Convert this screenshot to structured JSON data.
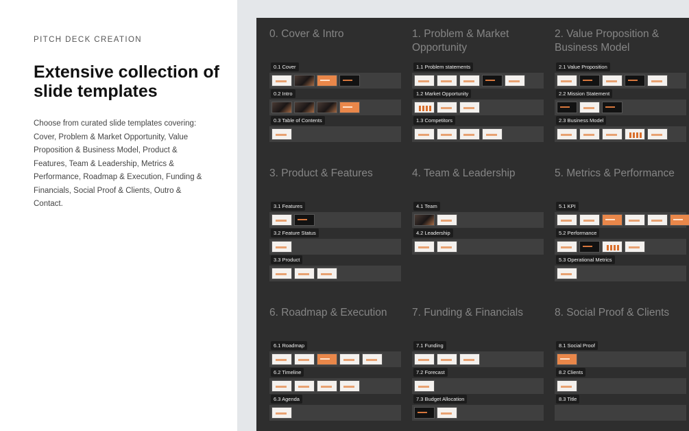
{
  "header": {
    "eyebrow": "PITCH DECK CREATION",
    "headline": "Extensive collection of slide templates",
    "description": "Choose from curated slide templates covering: Cover, Problem & Market Opportunity, Value Proposition & Business Model, Product & Features, Team & Leadership, Metrics & Performance, Roadmap & Execution, Funding & Financials, Social Proof & Clients, Outro & Contact."
  },
  "colors": {
    "panel": "#2e2e2e",
    "accent": "#e07a3a",
    "background": "#e4e7ea"
  },
  "categories": [
    {
      "title": "0. Cover & Intro",
      "sections": [
        {
          "label": "0.1 Cover",
          "thumbs": [
            "light",
            "photo",
            "orange",
            "dark"
          ]
        },
        {
          "label": "0.2 Intro",
          "thumbs": [
            "photo",
            "photo",
            "photo",
            "orange"
          ]
        },
        {
          "label": "0.3 Table of Contents",
          "thumbs": [
            "light"
          ]
        }
      ]
    },
    {
      "title": "1. Problem & Market Opportunity",
      "sections": [
        {
          "label": "1.1 Problem statements",
          "thumbs": [
            "light",
            "light",
            "light",
            "dark",
            "light"
          ]
        },
        {
          "label": "1.2 Market Opportunity",
          "thumbs": [
            "bars",
            "light",
            "light"
          ]
        },
        {
          "label": "1.3 Competitors",
          "thumbs": [
            "light",
            "light",
            "light",
            "light"
          ]
        }
      ]
    },
    {
      "title": "2. Value Proposition & Business Model",
      "sections": [
        {
          "label": "2.1 Value Proposition",
          "thumbs": [
            "light",
            "dark",
            "light",
            "dark",
            "light"
          ]
        },
        {
          "label": "2.2 Mission Statement",
          "thumbs": [
            "dark",
            "light",
            "dark"
          ]
        },
        {
          "label": "2.3 Business Model",
          "thumbs": [
            "light",
            "light",
            "light",
            "bars",
            "light"
          ]
        }
      ]
    },
    {
      "title": "3. Product & Features",
      "sections": [
        {
          "label": "3.1 Features",
          "thumbs": [
            "light",
            "dark"
          ]
        },
        {
          "label": "3.2 Feature Status",
          "thumbs": [
            "light"
          ]
        },
        {
          "label": "3.3 Product",
          "thumbs": [
            "light",
            "light",
            "light"
          ]
        }
      ]
    },
    {
      "title": "4. Team & Leadership",
      "sections": [
        {
          "label": "4.1 Team",
          "thumbs": [
            "photo",
            "light"
          ]
        },
        {
          "label": "4.2 Leadership",
          "thumbs": [
            "light",
            "light"
          ]
        }
      ]
    },
    {
      "title": "5. Metrics & Performance",
      "sections": [
        {
          "label": "5.1 KPI",
          "thumbs": [
            "light",
            "light",
            "orange",
            "light",
            "light",
            "orange"
          ]
        },
        {
          "label": "5.2 Performance",
          "thumbs": [
            "light",
            "dark",
            "bars",
            "light"
          ]
        },
        {
          "label": "5.3 Operational Metrics",
          "thumbs": [
            "light"
          ]
        }
      ]
    },
    {
      "title": "6. Roadmap & Execution",
      "sections": [
        {
          "label": "6.1 Roadmap",
          "thumbs": [
            "light",
            "light",
            "orange",
            "light",
            "light"
          ]
        },
        {
          "label": "6.2 Timeline",
          "thumbs": [
            "light",
            "light",
            "light",
            "light"
          ]
        },
        {
          "label": "6.3 Agenda",
          "thumbs": [
            "light"
          ]
        }
      ]
    },
    {
      "title": "7. Funding & Financials",
      "sections": [
        {
          "label": "7.1 Funding",
          "thumbs": [
            "light",
            "light",
            "light"
          ]
        },
        {
          "label": "7.2 Forecast",
          "thumbs": [
            "light"
          ]
        },
        {
          "label": "7.3 Budget Allocation",
          "thumbs": [
            "dark",
            "light"
          ]
        }
      ]
    },
    {
      "title": "8. Social Proof & Clients",
      "sections": [
        {
          "label": "8.1 Social Proof",
          "thumbs": [
            "orange"
          ]
        },
        {
          "label": "8.2 Clients",
          "thumbs": [
            "light"
          ]
        },
        {
          "label": "8.3 Title",
          "thumbs": []
        }
      ]
    }
  ]
}
